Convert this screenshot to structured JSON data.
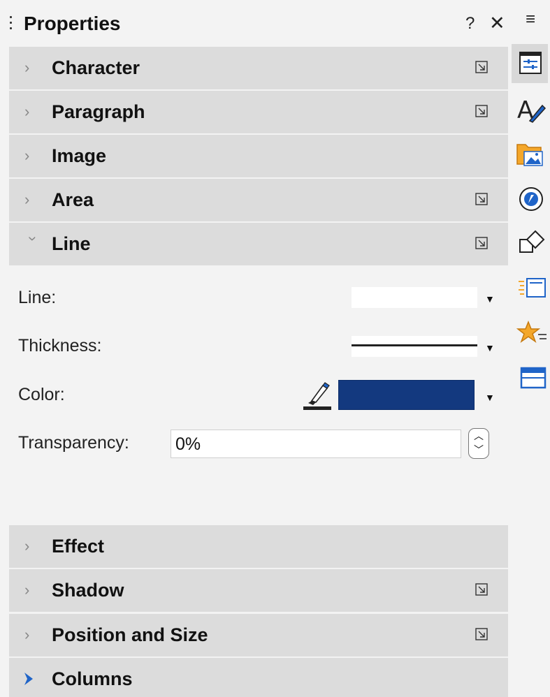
{
  "panel": {
    "title": "Properties",
    "help": "?",
    "close": "✕",
    "menu": "≡"
  },
  "sections_top": [
    {
      "label": "Character",
      "expanded": false,
      "has_more": true
    },
    {
      "label": "Paragraph",
      "expanded": false,
      "has_more": true
    },
    {
      "label": "Image",
      "expanded": false,
      "has_more": false
    },
    {
      "label": "Area",
      "expanded": false,
      "has_more": true
    },
    {
      "label": "Line",
      "expanded": true,
      "has_more": true
    }
  ],
  "line_panel": {
    "line_label": "Line:",
    "thickness_label": "Thickness:",
    "color_label": "Color:",
    "color_value": "#13397f",
    "transparency_label": "Transparency:",
    "transparency_value": "0%"
  },
  "sections_bottom": [
    {
      "label": "Effect",
      "expanded": false,
      "has_more": false
    },
    {
      "label": "Shadow",
      "expanded": false,
      "has_more": true
    },
    {
      "label": "Position and Size",
      "expanded": false,
      "has_more": true
    },
    {
      "label": "Columns",
      "expanded": false,
      "has_more": false,
      "highlighted": true
    }
  ],
  "sidebar_tabs": [
    {
      "icon": "properties-icon",
      "active": true
    },
    {
      "icon": "styles-icon",
      "active": false
    },
    {
      "icon": "gallery-icon",
      "active": false
    },
    {
      "icon": "navigator-icon",
      "active": false
    },
    {
      "icon": "shapes-icon",
      "active": false
    },
    {
      "icon": "slide-transition-icon",
      "active": false
    },
    {
      "icon": "animation-icon",
      "active": false
    },
    {
      "icon": "master-slides-icon",
      "active": false
    }
  ]
}
